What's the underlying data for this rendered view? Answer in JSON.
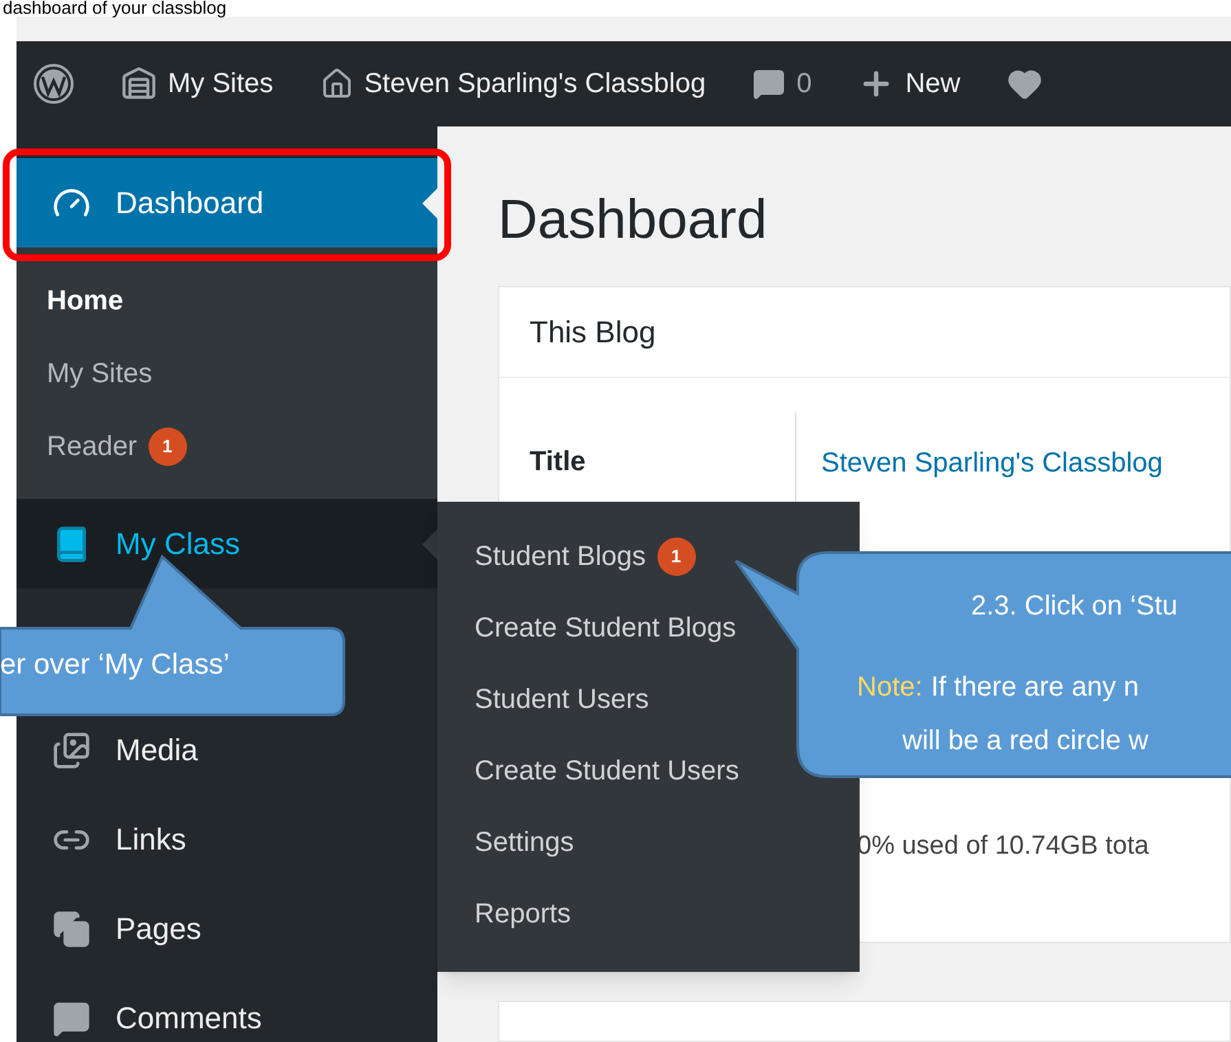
{
  "document_caption": "dashboard of your classblog",
  "admin_bar": {
    "items": [
      {
        "kind": "logo"
      },
      {
        "kind": "sites",
        "label": "My Sites"
      },
      {
        "kind": "home",
        "label": "Steven Sparling's Classblog"
      },
      {
        "kind": "comments",
        "label": "0"
      },
      {
        "kind": "new",
        "label": "New"
      },
      {
        "kind": "heart"
      }
    ]
  },
  "sidebar": {
    "items": [
      {
        "kind": "dashboard",
        "label": "Dashboard",
        "selected": true,
        "hovered": false,
        "outlined": true,
        "children": [
          {
            "label": "Home",
            "selected": true
          },
          {
            "label": "My Sites",
            "selected": false
          },
          {
            "label": "Reader",
            "badge": "1",
            "selected": false
          }
        ]
      },
      {
        "kind": "class",
        "label": "My Class",
        "selected": false,
        "hovered": true,
        "outlined": false
      },
      {
        "kind": "media",
        "label": "Media",
        "selected": false,
        "hovered": false,
        "outlined": false
      },
      {
        "kind": "links",
        "label": "Links",
        "selected": false,
        "hovered": false,
        "outlined": false
      },
      {
        "kind": "pages",
        "label": "Pages",
        "selected": false,
        "hovered": false,
        "outlined": false
      },
      {
        "kind": "comments",
        "label": "Comments",
        "selected": false,
        "hovered": false,
        "outlined": false
      }
    ]
  },
  "flyout": {
    "items": [
      {
        "label": "Student Blogs",
        "badge": "1"
      },
      {
        "label": "Create Student Blogs"
      },
      {
        "label": "Student Users"
      },
      {
        "label": "Create Student Users"
      },
      {
        "label": "Settings"
      },
      {
        "label": "Reports"
      }
    ]
  },
  "main": {
    "title": "Dashboard",
    "card": {
      "title": "This Blog",
      "row": {
        "label": "Title",
        "value": "Steven Sparling's Classblog"
      },
      "usage": "0% used of 10.74GB tota"
    }
  },
  "callouts": [
    {
      "lines": [
        "er over ‘My Class’"
      ]
    },
    {
      "title": "2.3. Click on ‘Stu",
      "note_label": "Note:",
      "note_lines": [
        "If there are any n",
        "will be a red circle w"
      ]
    }
  ]
}
